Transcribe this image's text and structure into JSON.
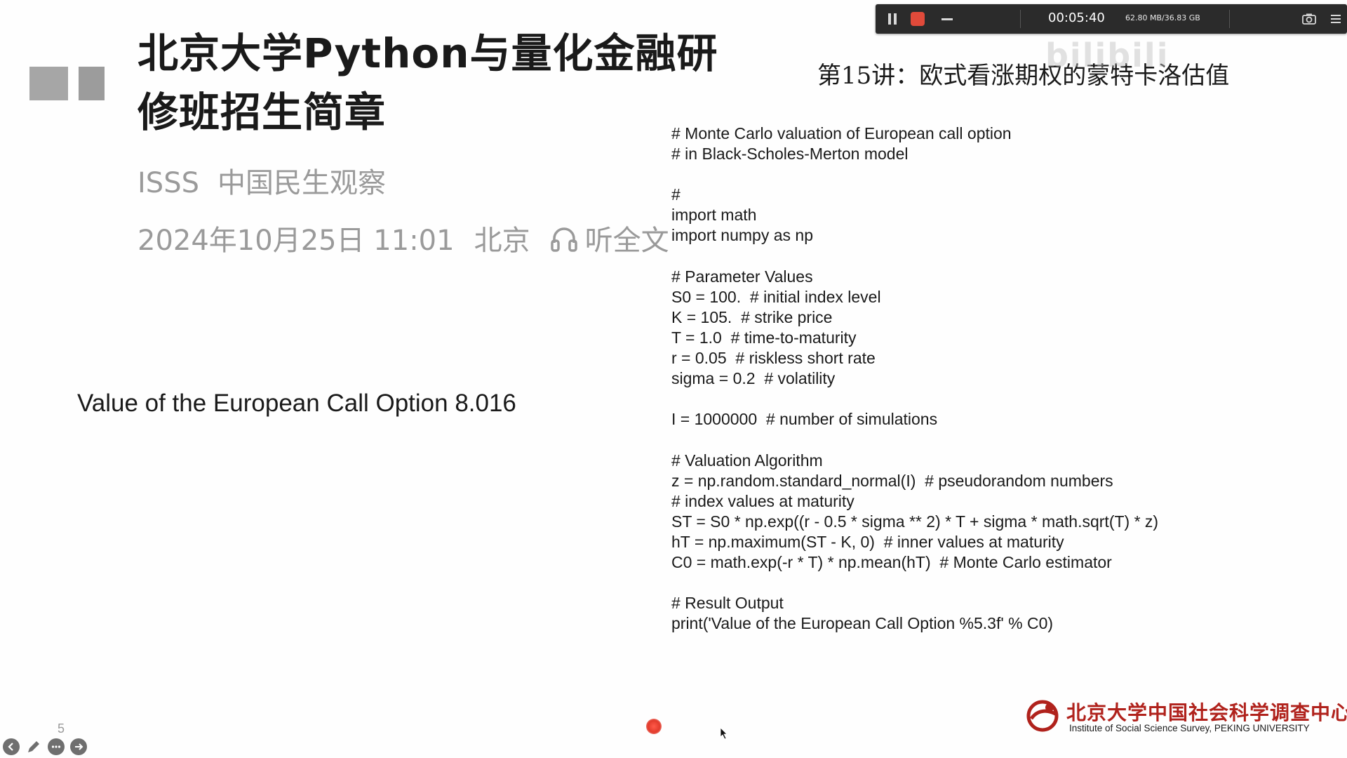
{
  "article": {
    "headline": "北京大学Python与量化金融研修班招生简章",
    "source_org": "ISSS",
    "source_name": "中国民生观察",
    "date": "2024年10月25日 11:01",
    "location": "北京",
    "listen_label": "听全文"
  },
  "slide": {
    "lecture_title": "第15讲：欧式看涨期权的蒙特卡洛估值",
    "result_text": "Value of the European Call Option 8.016",
    "code_lines": [
      "# Monte Carlo valuation of European call option",
      "# in Black-Scholes-Merton model",
      "",
      "#",
      "import math",
      "import numpy as np",
      "",
      "# Parameter Values",
      "S0 = 100.  # initial index level",
      "K = 105.  # strike price",
      "T = 1.0  # time-to-maturity",
      "r = 0.05  # riskless short rate",
      "sigma = 0.2  # volatility",
      "",
      "I = 1000000  # number of simulations",
      "",
      "# Valuation Algorithm",
      "z = np.random.standard_normal(I)  # pseudorandom numbers",
      "# index values at maturity",
      "ST = S0 * np.exp((r - 0.5 * sigma ** 2) * T + sigma * math.sqrt(T) * z)",
      "hT = np.maximum(ST - K, 0)  # inner values at maturity",
      "C0 = math.exp(-r * T) * np.mean(hT)  # Monte Carlo estimator",
      "",
      "# Result Output",
      "print('Value of the European Call Option %5.3f' % C0)"
    ],
    "page_number": "5",
    "footer_cn": "北京大学中国社会科学调查中心",
    "footer_en": "Institute of Social Science Survey, PEKING UNIVERSITY"
  },
  "recorder": {
    "elapsed": "00:05:40",
    "storage": "62.80 MB/36.83 GB",
    "icons": [
      "pause-icon",
      "stop-icon",
      "minimize-icon",
      "camera-icon",
      "menu-icon"
    ],
    "stop_color": "#e04a3a"
  },
  "watermark": "bilibili",
  "toolbar": {
    "icons": [
      "back-icon",
      "pen-icon",
      "more-icon",
      "forward-icon"
    ]
  },
  "colors": {
    "logo_red": "#b0221c",
    "muted_text": "#9a9a9a"
  }
}
